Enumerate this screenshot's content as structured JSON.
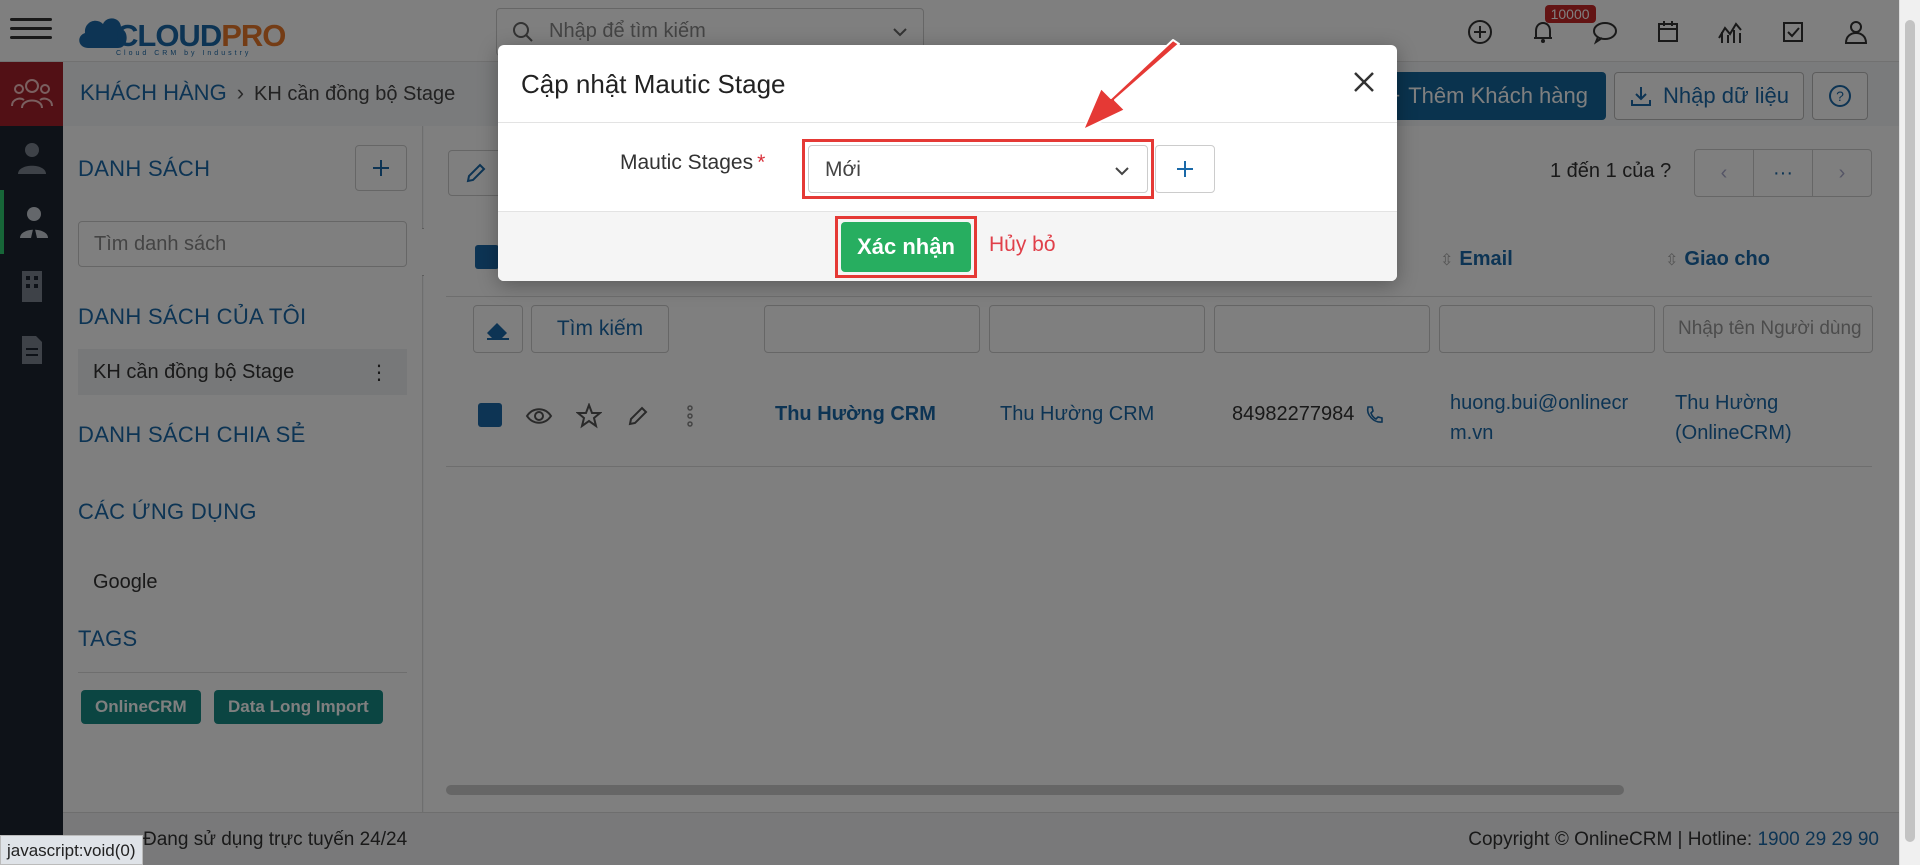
{
  "header": {
    "logo_main": "CLOUD",
    "logo_accent": "PRO",
    "logo_tagline": "Cloud CRM by Industry",
    "search_placeholder": "Nhập để tìm kiếm",
    "notification_count": "10000",
    "icons": [
      "plus-circle-icon",
      "bell-icon",
      "chat-icon",
      "calendar-icon",
      "chart-icon",
      "checkbox-icon",
      "user-icon"
    ]
  },
  "breadcrumb": {
    "module": "KHÁCH HÀNG",
    "list": "KH cần đồng bộ Stage"
  },
  "actions": {
    "add_label": "Thêm Khách hàng",
    "import_label": "Nhập dữ liệu"
  },
  "sidebar": {
    "list_title": "DANH SÁCH",
    "search_placeholder": "Tìm danh sách",
    "my_lists_title": "DANH SÁCH CỦA TÔI",
    "my_list_item": "KH cần đồng bộ Stage",
    "shared_title": "DANH SÁCH CHIA SẺ",
    "apps_title": "CÁC ỨNG DỤNG",
    "app_item": "Google",
    "tags_title": "TAGS",
    "tags": [
      "OnlineCRM",
      "Data Long Import"
    ]
  },
  "table": {
    "pager_text": "1 đến 1 của",
    "pager_help": "?",
    "pager_more": "···",
    "col_email": "Email",
    "col_assigned": "Giao cho",
    "find_label": "Tìm kiếm",
    "user_filter_placeholder": "Nhập tên Người dùng",
    "row": {
      "name": "Thu Hường CRM",
      "company": "Thu Hường CRM",
      "phone": "84982277984",
      "email_line1": "huong.bui@onlinecr",
      "email_line2": "m.vn",
      "assigned_line1": "Thu Hường",
      "assigned_line2": "(OnlineCRM)"
    }
  },
  "footer": {
    "online_text": "Đang sử dụng trực tuyến 24/24",
    "copyright": "Copyright © OnlineCRM | Hotline:",
    "hotline": "1900 29 29 90",
    "status_tip": "javascript:void(0)"
  },
  "modal": {
    "title": "Cập nhật Mautic Stage",
    "field_label": "Mautic Stages",
    "required_mark": "*",
    "selected_value": "Mới",
    "confirm_label": "Xác nhận",
    "cancel_label": "Hủy bỏ"
  },
  "colors": {
    "primary": "#1a69a8",
    "accent": "#e9782a",
    "confirm": "#27ae60",
    "highlight": "#e53935",
    "tag": "#178a85"
  }
}
